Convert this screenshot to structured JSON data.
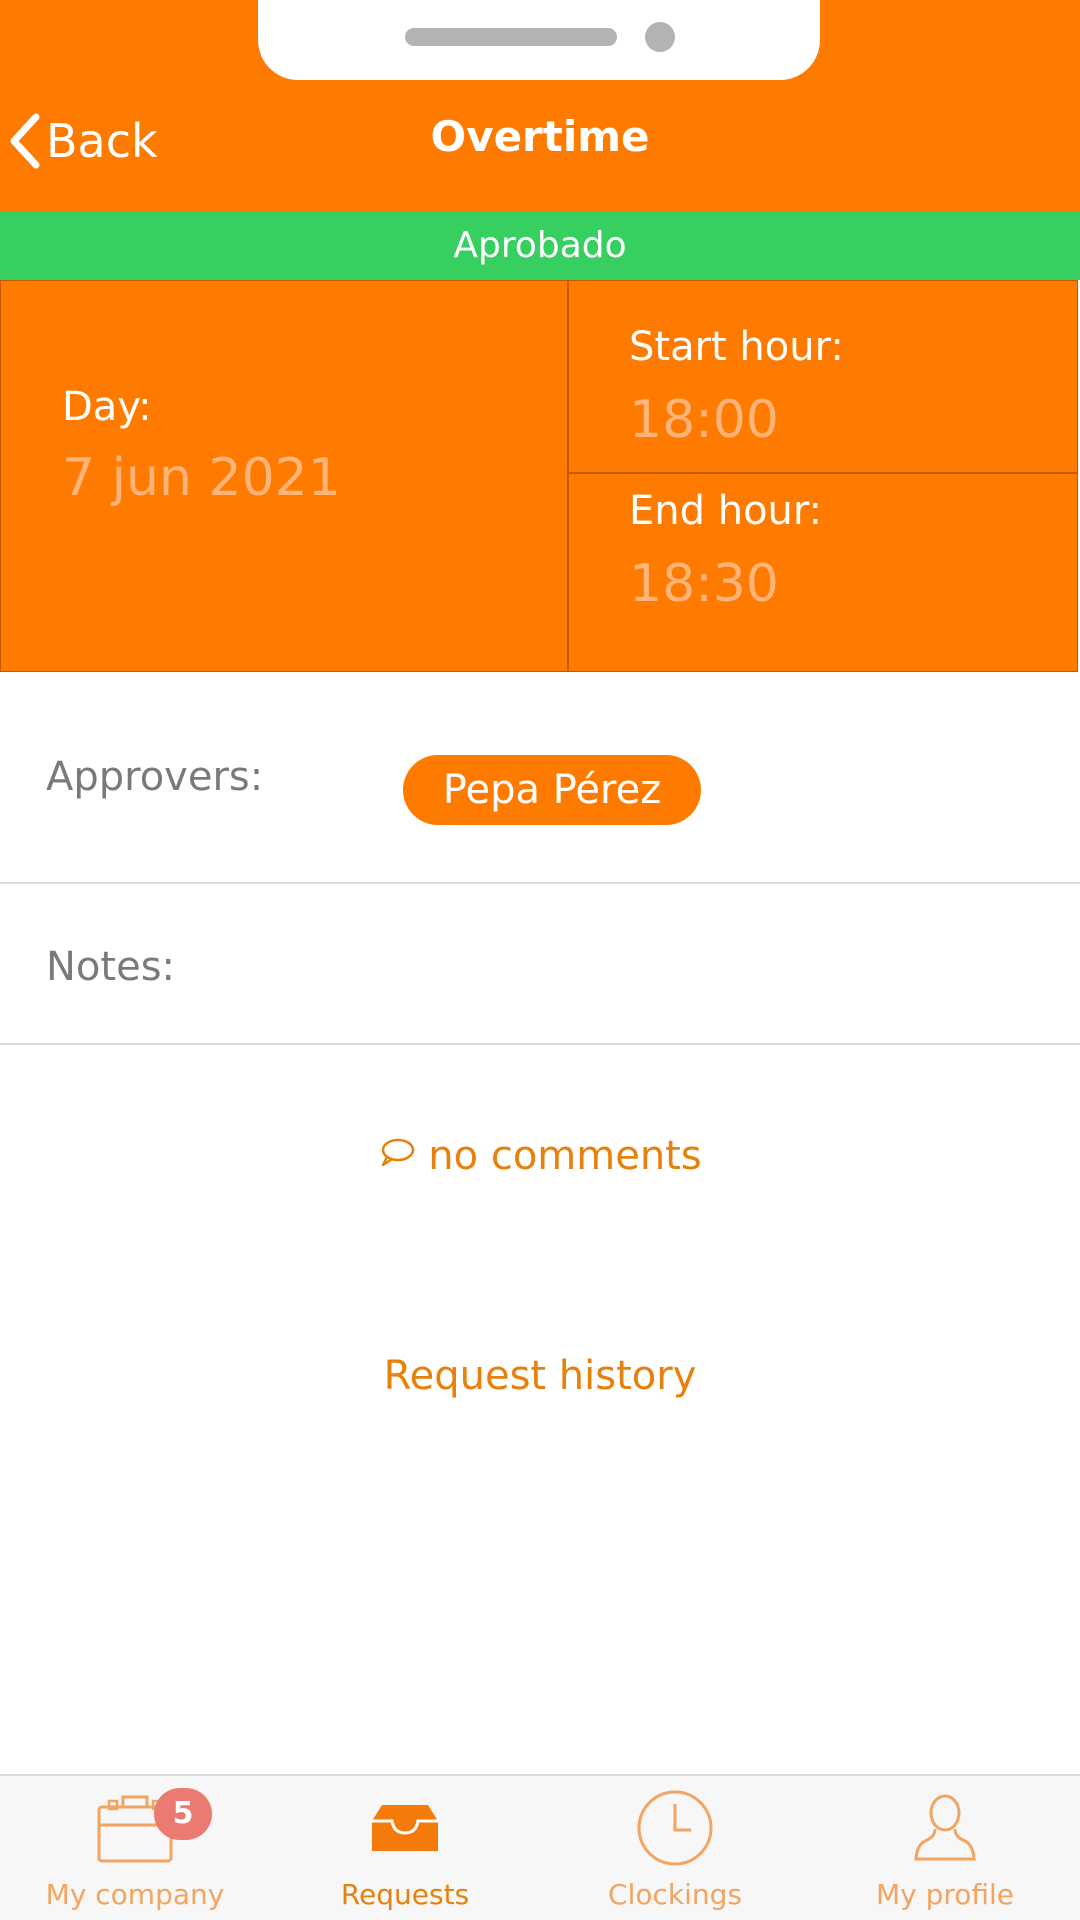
{
  "colors": {
    "accent": "#fe7b00",
    "status_green": "#37cf60",
    "link_orange": "#e8800c",
    "badge_red": "#ea7a72"
  },
  "header": {
    "back_label": "Back",
    "title": "Overtime"
  },
  "status": {
    "label": "Aprobado"
  },
  "details": {
    "day_label": "Day:",
    "day_value": "7 jun 2021",
    "start_label": "Start hour:",
    "start_value": "18:00",
    "end_label": "End hour:",
    "end_value": "18:30"
  },
  "approvers": {
    "label": "Approvers:",
    "names": [
      "Pepa Pérez"
    ]
  },
  "notes": {
    "label": "Notes:"
  },
  "comments": {
    "icon": "comment-icon",
    "label": "no comments"
  },
  "history": {
    "label": "Request history"
  },
  "tabs": [
    {
      "label": "My company",
      "icon": "briefcase-icon",
      "badge": "5",
      "active": false
    },
    {
      "label": "Requests",
      "icon": "inbox-icon",
      "active": true
    },
    {
      "label": "Clockings",
      "icon": "clock-icon",
      "active": false
    },
    {
      "label": "My profile",
      "icon": "person-icon",
      "active": false
    }
  ]
}
